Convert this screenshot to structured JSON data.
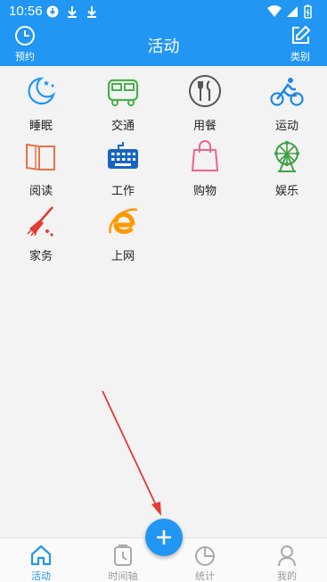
{
  "status_bar": {
    "time": "10:56"
  },
  "header": {
    "title": "活动",
    "left_button": {
      "label": "预约",
      "icon": "clock-icon"
    },
    "right_button": {
      "label": "类别",
      "icon": "edit-icon"
    }
  },
  "categories": [
    {
      "label": "睡眠",
      "icon": "moon-icon",
      "color": "#2196f3"
    },
    {
      "label": "交通",
      "icon": "bus-icon",
      "color": "#4caf50"
    },
    {
      "label": "用餐",
      "icon": "fork-knife-icon",
      "color": "#555555"
    },
    {
      "label": "运动",
      "icon": "cyclist-icon",
      "color": "#1e88e5"
    },
    {
      "label": "阅读",
      "icon": "book-icon",
      "color": "#e8734a"
    },
    {
      "label": "工作",
      "icon": "keyboard-icon",
      "color": "#1565c0"
    },
    {
      "label": "购物",
      "icon": "shopping-bag-icon",
      "color": "#f06292"
    },
    {
      "label": "娱乐",
      "icon": "ferris-wheel-icon",
      "color": "#43a047"
    },
    {
      "label": "家务",
      "icon": "broom-icon",
      "color": "#e53935"
    },
    {
      "label": "上网",
      "icon": "browser-e-icon",
      "color": "#ff9800"
    }
  ],
  "fab": {
    "icon": "plus-icon"
  },
  "bottom_nav": [
    {
      "label": "活动",
      "icon": "home-icon",
      "active": true
    },
    {
      "label": "时间轴",
      "icon": "timeline-clock-icon",
      "active": false
    },
    {
      "label": "统计",
      "icon": "pie-chart-icon",
      "active": false
    },
    {
      "label": "我的",
      "icon": "person-icon",
      "active": false
    }
  ],
  "colors": {
    "primary": "#2196f3",
    "background": "#f3f3f3",
    "annotation_arrow": "#e53935"
  }
}
